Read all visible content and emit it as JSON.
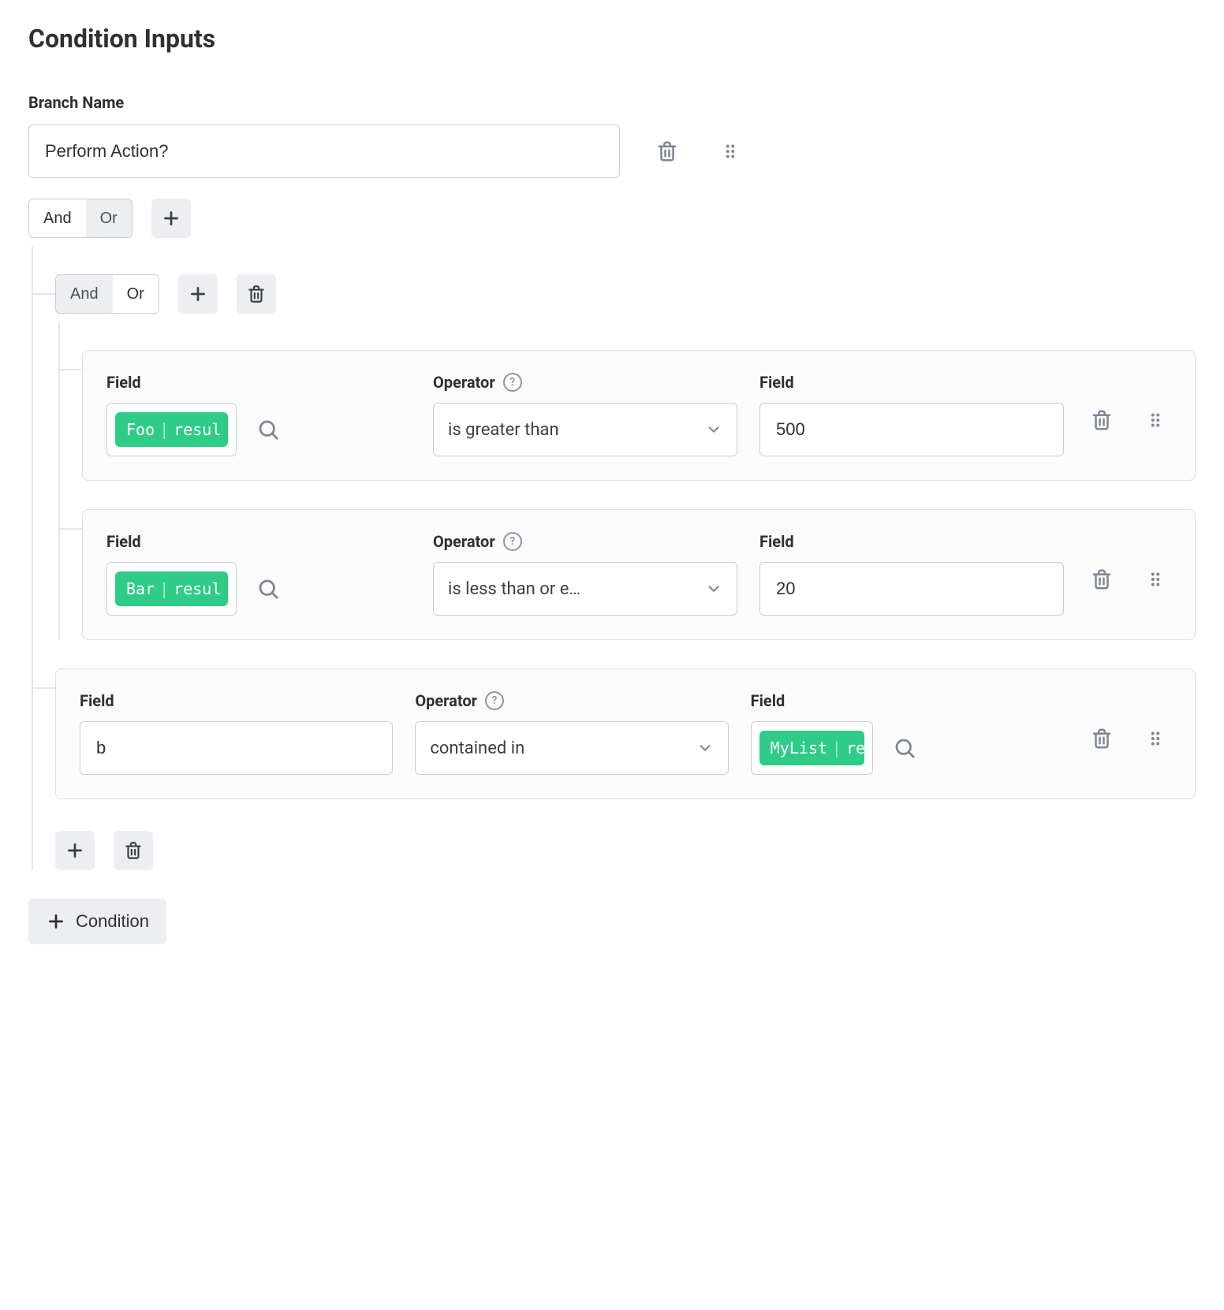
{
  "title": "Condition Inputs",
  "branch": {
    "label": "Branch Name",
    "value": "Perform Action?"
  },
  "labels": {
    "and": "And",
    "or": "Or",
    "field": "Field",
    "operator": "Operator",
    "condition": "Condition"
  },
  "root": {
    "logic_active": "and",
    "children": [
      {
        "type": "group",
        "logic_active": "or",
        "rules": [
          {
            "left_chip": {
              "name": "Foo",
              "attr": "resul"
            },
            "operator": "is greater than",
            "right_value": "500"
          },
          {
            "left_chip": {
              "name": "Bar",
              "attr": "resul"
            },
            "operator": "is less than or e…",
            "right_value": "20"
          }
        ]
      },
      {
        "type": "rule",
        "left_value": "b",
        "operator": "contained in",
        "right_chip": {
          "name": "MyList",
          "attr": "re"
        }
      }
    ]
  }
}
